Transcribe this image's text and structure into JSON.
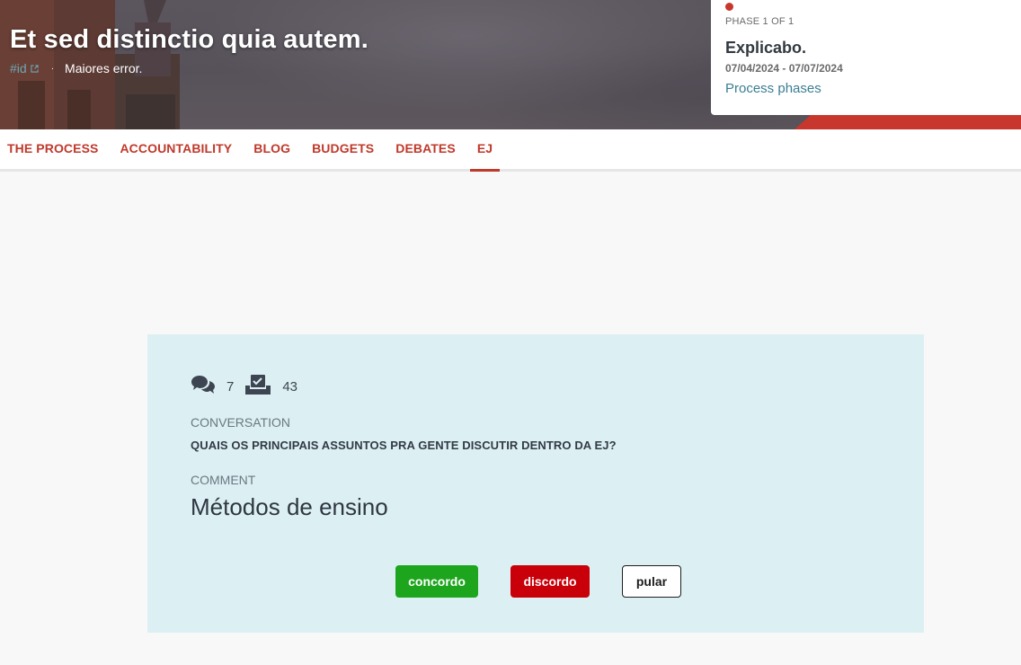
{
  "hero": {
    "title": "Et sed distinctio quia autem.",
    "hashtag": "#id",
    "separator": "·",
    "subtitle": "Maiores error."
  },
  "phase": {
    "label": "PHASE 1 OF 1",
    "title": "Explicabo.",
    "dates": "07/04/2024 - 07/07/2024",
    "link": "Process phases"
  },
  "nav": {
    "tabs": [
      {
        "label": "THE PROCESS"
      },
      {
        "label": "ACCOUNTABILITY"
      },
      {
        "label": "BLOG"
      },
      {
        "label": "BUDGETS"
      },
      {
        "label": "DEBATES"
      },
      {
        "label": "EJ"
      }
    ],
    "active_tab": "EJ"
  },
  "card": {
    "comments_count": "7",
    "votes_count": "43",
    "conversation_label": "CONVERSATION",
    "conversation_title": "QUAIS OS PRINCIPAIS ASSUNTOS PRA GENTE DISCUTIR DENTRO DA EJ?",
    "comment_label": "COMMENT",
    "comment_text": "Métodos de ensino",
    "buttons": {
      "agree": "concordo",
      "disagree": "discordo",
      "skip": "pular"
    }
  },
  "icons": [
    "external-link-icon",
    "comments-icon",
    "vote-box-icon"
  ],
  "colors": {
    "accent_red": "#c0392b",
    "agree_green": "#1ea51e",
    "disagree_red": "#c9000a",
    "card_bg": "#dcf0f3",
    "link_teal": "#3a7e92"
  }
}
